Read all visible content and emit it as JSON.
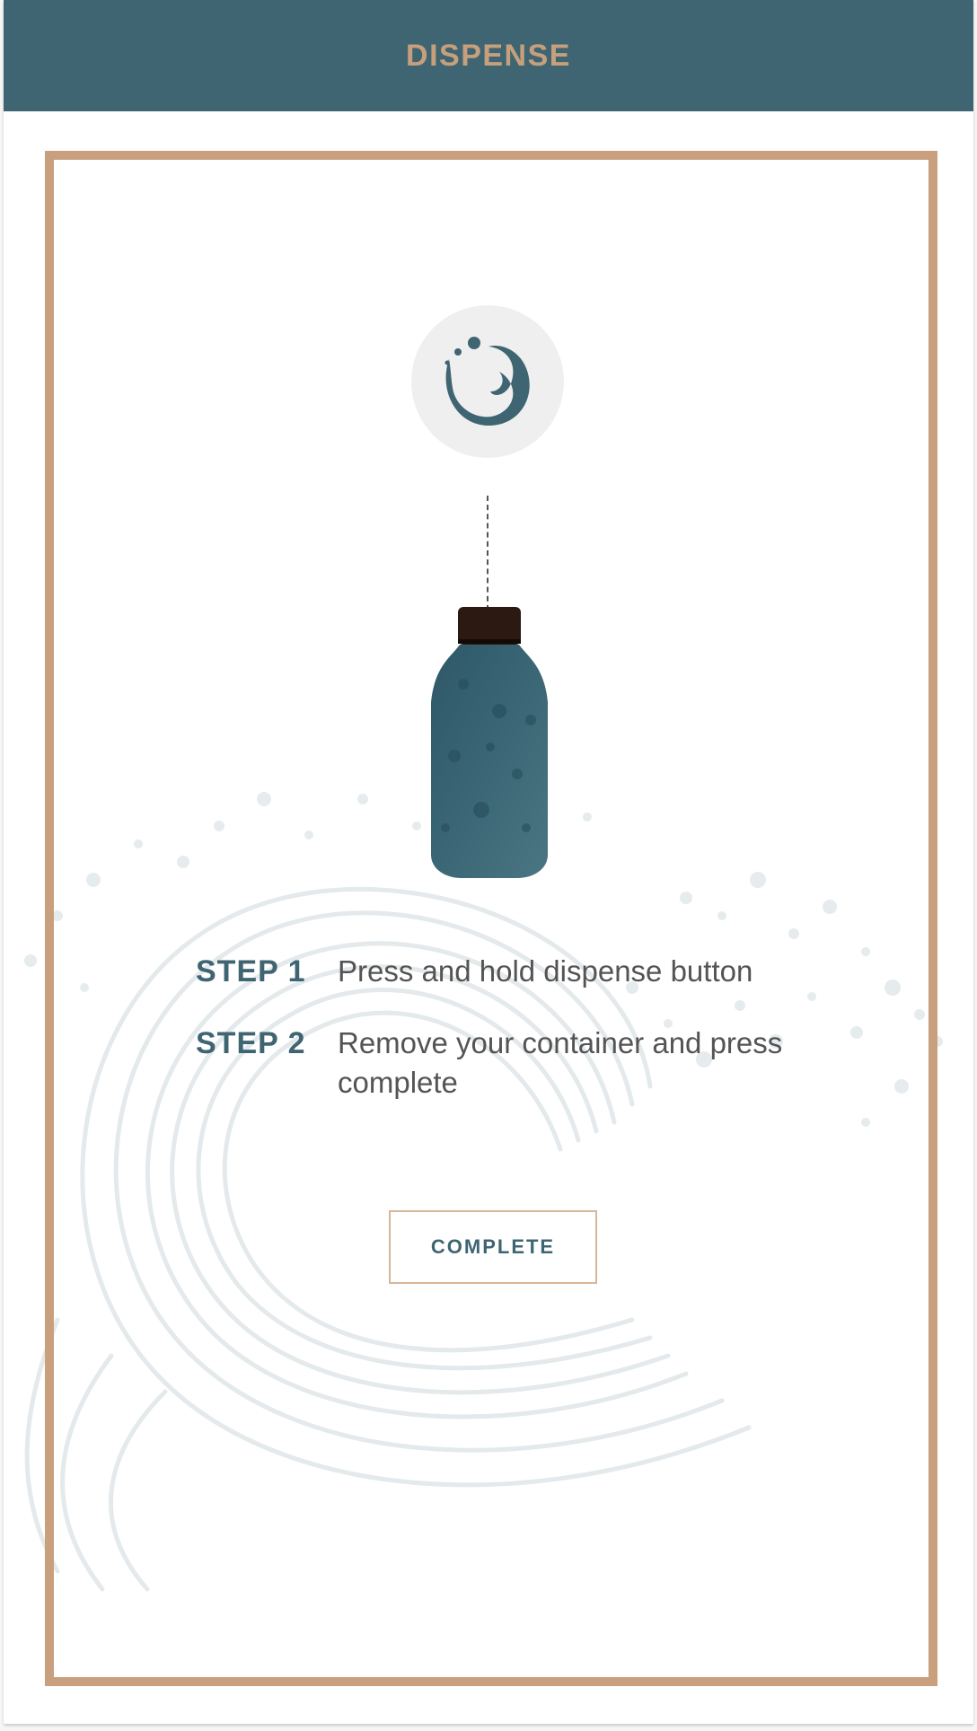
{
  "header": {
    "title": "DISPENSE"
  },
  "steps": [
    {
      "label": "STEP 1",
      "text": "Press and hold dispense button"
    },
    {
      "label": "STEP 2",
      "text": "Remove your container and press complete"
    }
  ],
  "actions": {
    "complete_label": "COMPLETE"
  },
  "icons": {
    "logo": "water-swirl-logo-icon",
    "bottle": "bottle-icon",
    "background": "water-splash-background"
  },
  "colors": {
    "header_bg": "#3f6573",
    "accent_tan": "#c8a07e",
    "primary_teal": "#3f6573",
    "bottle_cap": "#2c1a12",
    "body_text": "#545454"
  }
}
